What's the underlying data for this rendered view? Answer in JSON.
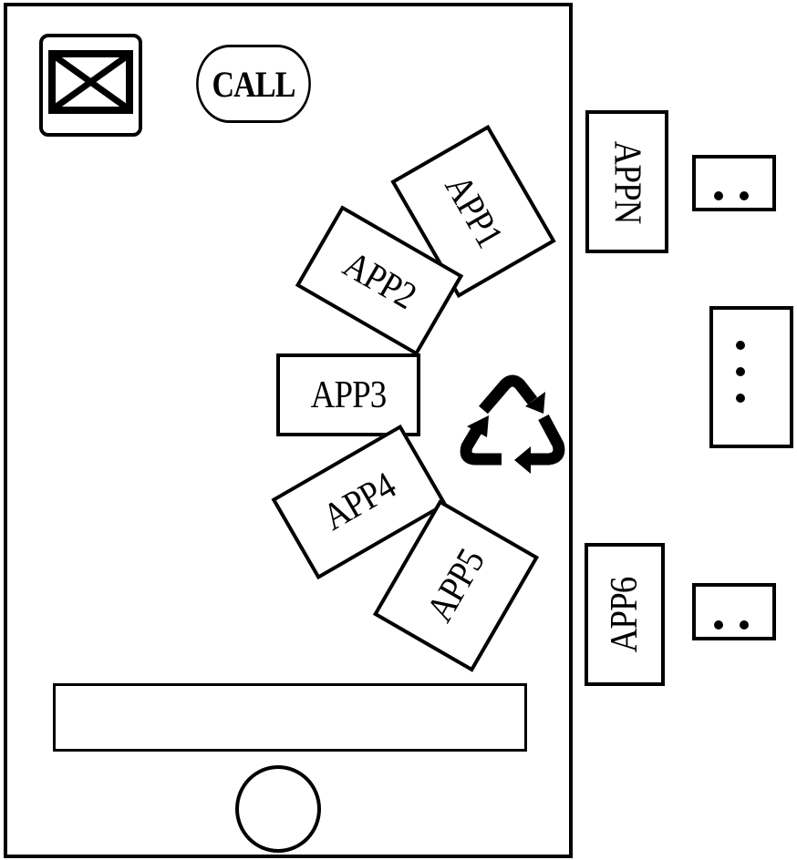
{
  "phone": {
    "mail_icon": "envelope-icon",
    "call_label": "CALL",
    "recycle_icon": "recycle-icon",
    "apps_on_screen": [
      {
        "label": "APP1"
      },
      {
        "label": "APP2"
      },
      {
        "label": "APP3"
      },
      {
        "label": "APP4"
      },
      {
        "label": "APP5"
      }
    ],
    "input_bar_value": "",
    "home_button_icon": "circle-icon"
  },
  "offscreen": {
    "apps": [
      {
        "label": "APPN"
      },
      {
        "label": "APP6"
      }
    ],
    "ellipsis_boxes": [
      {
        "dots": 2,
        "orientation": "horizontal"
      },
      {
        "dots": 3,
        "orientation": "vertical"
      },
      {
        "dots": 2,
        "orientation": "horizontal"
      }
    ]
  }
}
